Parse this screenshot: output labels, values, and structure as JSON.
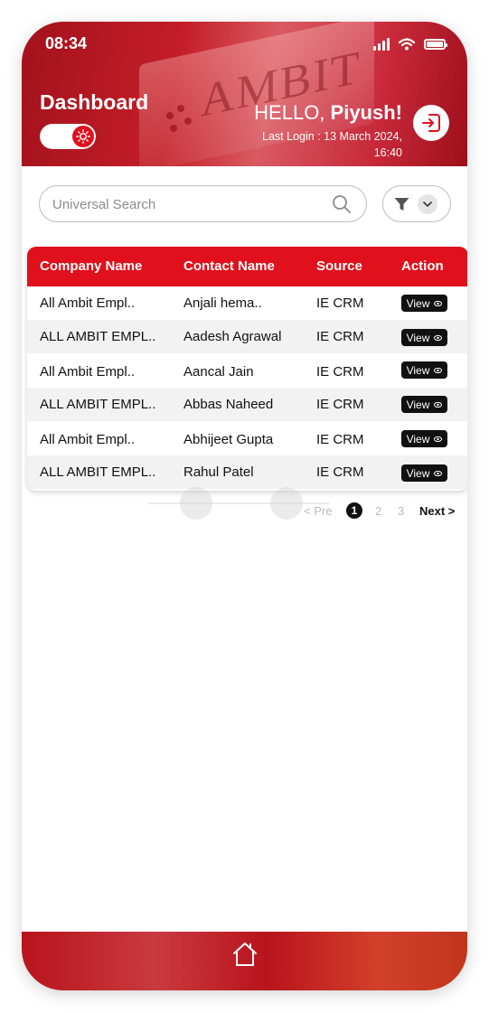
{
  "status_bar": {
    "time": "08:34"
  },
  "header": {
    "title": "Dashboard",
    "sign_text": "AMBIT",
    "greeting_prefix": "HELLO, ",
    "user_name": "Piyush!",
    "last_login": "Last Login : 13 March 2024, 16:40"
  },
  "search": {
    "placeholder": "Universal Search"
  },
  "table": {
    "columns": [
      "Company Name",
      "Contact Name",
      "Source",
      "Action"
    ],
    "rows": [
      {
        "company": "All Ambit Empl..",
        "contact": "Anjali hema..",
        "source": "IE CRM",
        "action": "View"
      },
      {
        "company": "ALL AMBIT EMPL..",
        "contact": "Aadesh Agrawal",
        "source": "IE CRM",
        "action": "View"
      },
      {
        "company": "All Ambit Empl..",
        "contact": "Aancal Jain",
        "source": "IE CRM",
        "action": "View"
      },
      {
        "company": "ALL AMBIT EMPL..",
        "contact": "Abbas Naheed",
        "source": "IE CRM",
        "action": "View"
      },
      {
        "company": "All Ambit Empl..",
        "contact": "Abhijeet Gupta",
        "source": "IE CRM",
        "action": "View"
      },
      {
        "company": "ALL AMBIT EMPL..",
        "contact": "Rahul Patel",
        "source": "IE CRM",
        "action": "View"
      }
    ]
  },
  "pagination": {
    "prev": "< Pre",
    "pages": [
      "1",
      "2",
      "3"
    ],
    "current": "1",
    "next": "Next >"
  },
  "icons": {
    "theme_toggle": "sun-icon",
    "logout": "logout-icon",
    "search": "search-icon",
    "filter": "filter-icon",
    "dropdown": "chevron-down-icon",
    "view": "eye-icon",
    "home": "home-icon"
  },
  "colors": {
    "brand_red": "#e0101c",
    "dark": "#111111"
  }
}
